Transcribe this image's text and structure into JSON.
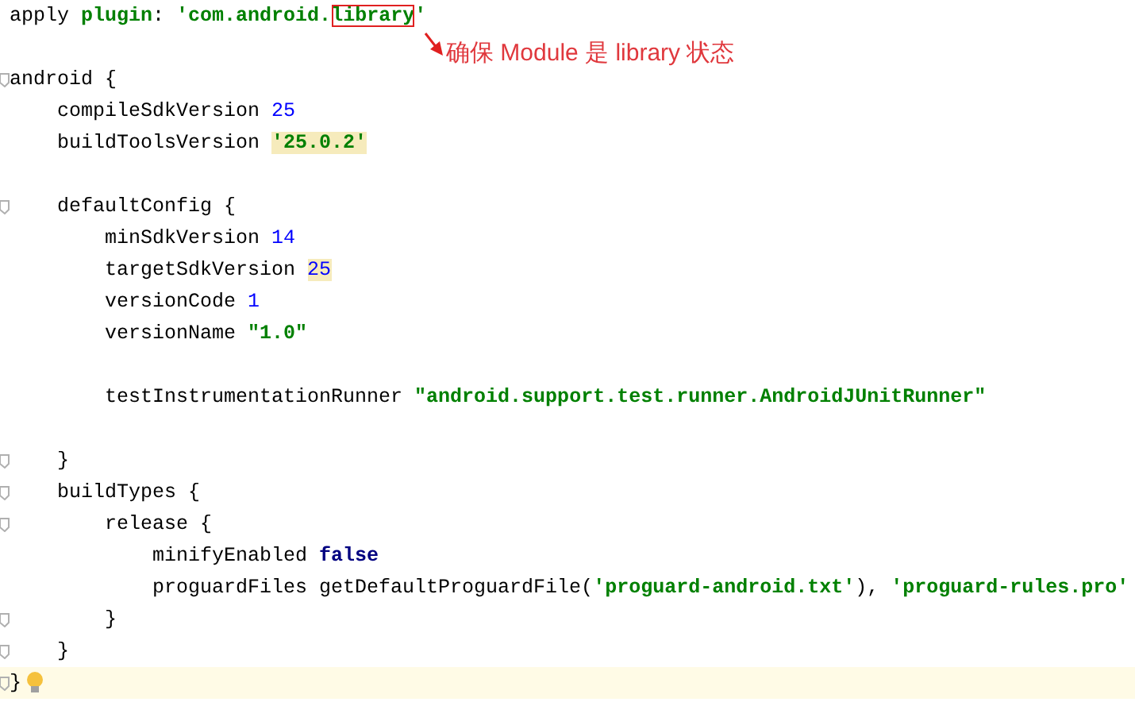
{
  "editor": {
    "paragraphs": [
      {
        "lines": [
          {
            "segments": [
              {
                "kind": "plain",
                "text": "apply "
              },
              {
                "kind": "keyword-arg",
                "text": "plugin"
              },
              {
                "kind": "plain",
                "text": ": "
              },
              {
                "kind": "string",
                "text": "'com.android."
              },
              {
                "kind": "string",
                "text": "library",
                "boxed": true
              },
              {
                "kind": "string",
                "text": "'"
              }
            ]
          }
        ]
      },
      {
        "lines": [
          {
            "fold": true,
            "segments": [
              {
                "kind": "plain",
                "text": "android {"
              }
            ]
          },
          {
            "segments": [
              {
                "kind": "plain",
                "text": "    compileSdkVersion "
              },
              {
                "kind": "number",
                "text": "25"
              }
            ]
          },
          {
            "segments": [
              {
                "kind": "plain",
                "text": "    buildToolsVersion "
              },
              {
                "kind": "string",
                "text": "'25.0.2'",
                "highlight": true
              }
            ]
          }
        ]
      },
      {
        "lines": [
          {
            "fold": true,
            "segments": [
              {
                "kind": "plain",
                "text": "    defaultConfig {"
              }
            ]
          },
          {
            "segments": [
              {
                "kind": "plain",
                "text": "        minSdkVersion "
              },
              {
                "kind": "number",
                "text": "14"
              }
            ]
          },
          {
            "segments": [
              {
                "kind": "plain",
                "text": "        targetSdkVersion "
              },
              {
                "kind": "number",
                "text": "25",
                "highlight": true
              }
            ]
          },
          {
            "segments": [
              {
                "kind": "plain",
                "text": "        versionCode "
              },
              {
                "kind": "number",
                "text": "1"
              }
            ]
          },
          {
            "segments": [
              {
                "kind": "plain",
                "text": "        versionName "
              },
              {
                "kind": "string",
                "text": "\"1.0\""
              }
            ]
          }
        ]
      },
      {
        "lines": [
          {
            "segments": [
              {
                "kind": "plain",
                "text": "        testInstrumentationRunner "
              },
              {
                "kind": "string",
                "text": "\"android.support.test.runner.AndroidJUnitRunner\""
              }
            ]
          }
        ]
      },
      {
        "lines": [
          {
            "fold": true,
            "segments": [
              {
                "kind": "plain",
                "text": "    }"
              }
            ]
          },
          {
            "fold": true,
            "segments": [
              {
                "kind": "plain",
                "text": "    buildTypes {"
              }
            ]
          },
          {
            "fold": true,
            "segments": [
              {
                "kind": "plain",
                "text": "        release {"
              }
            ]
          },
          {
            "segments": [
              {
                "kind": "plain",
                "text": "            minifyEnabled "
              },
              {
                "kind": "keyword",
                "text": "false"
              }
            ]
          },
          {
            "segments": [
              {
                "kind": "plain",
                "text": "            proguardFiles getDefaultProguardFile("
              },
              {
                "kind": "string",
                "text": "'proguard-android.txt'"
              },
              {
                "kind": "plain",
                "text": "), "
              },
              {
                "kind": "string",
                "text": "'proguard-rules.pro'"
              }
            ]
          },
          {
            "fold": true,
            "segments": [
              {
                "kind": "plain",
                "text": "        }"
              }
            ]
          },
          {
            "fold": true,
            "segments": [
              {
                "kind": "plain",
                "text": "    }"
              }
            ]
          },
          {
            "fold": true,
            "current": true,
            "segments": [
              {
                "kind": "plain",
                "text": "}"
              }
            ]
          }
        ]
      }
    ]
  },
  "annotation": {
    "text": "确保 Module 是 library 状态"
  }
}
